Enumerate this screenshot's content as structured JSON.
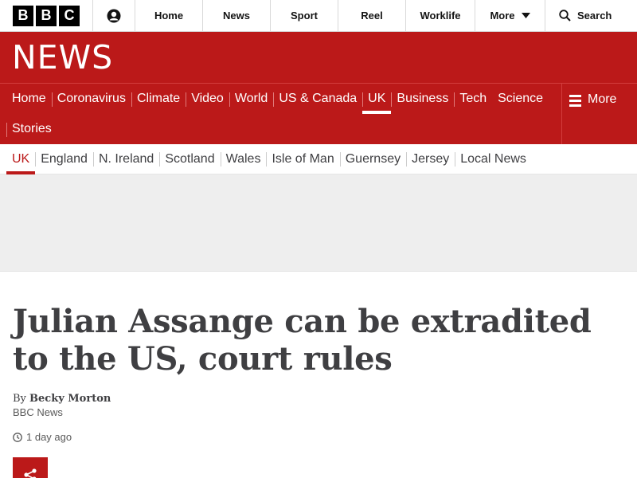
{
  "global_nav": {
    "logo_letters": [
      "B",
      "B",
      "C"
    ],
    "items": [
      "Home",
      "News",
      "Sport",
      "Reel",
      "Worklife"
    ],
    "more_label": "More",
    "search_label": "Search"
  },
  "masthead": {
    "title": "NEWS"
  },
  "section_nav": {
    "row1": [
      "Home",
      "Coronavirus",
      "Climate",
      "Video",
      "World",
      "US & Canada",
      "UK",
      "Business",
      "Tech"
    ],
    "row2": [
      "Science",
      "Stories"
    ],
    "active": "UK",
    "more_label": "More"
  },
  "sub_nav": {
    "items": [
      "UK",
      "England",
      "N. Ireland",
      "Scotland",
      "Wales",
      "Isle of Man",
      "Guernsey",
      "Jersey",
      "Local News"
    ],
    "active": "UK"
  },
  "article": {
    "headline": "Julian Assange can be extradited to the US, court rules",
    "byline_prefix": "By ",
    "author": "Becky Morton",
    "organisation": "BBC News",
    "timestamp": "1 day ago"
  },
  "colors": {
    "brand_red": "#bb1919",
    "headline_text": "#3f3f42"
  },
  "icons": [
    "account-icon",
    "chevron-down-icon",
    "search-icon",
    "menu-icon",
    "clock-icon",
    "share-icon"
  ]
}
